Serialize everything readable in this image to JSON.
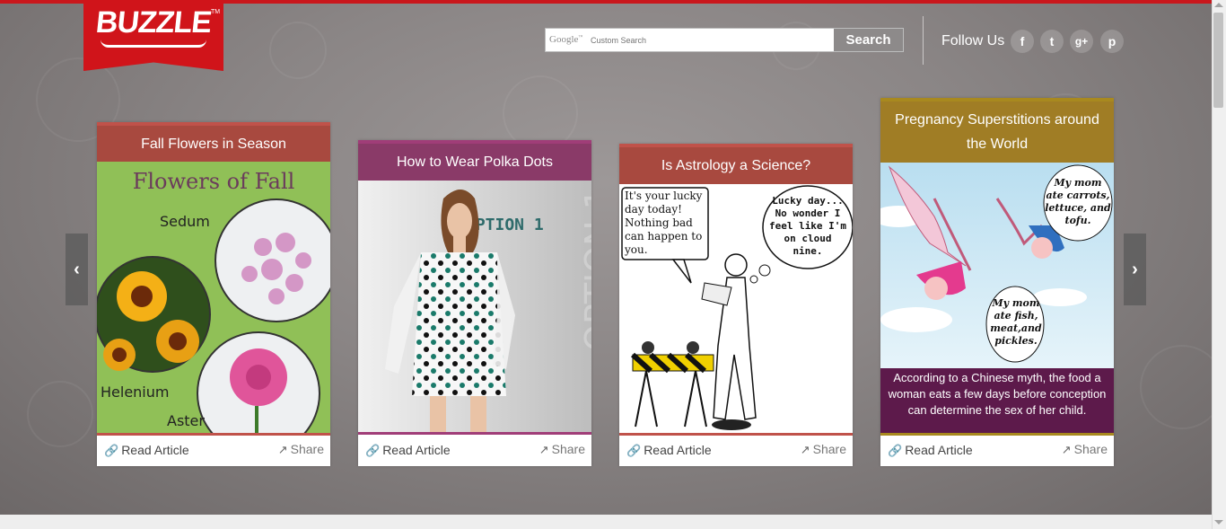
{
  "brand": {
    "logo_text": "BUZZLE",
    "tm": "TM",
    "color": "#d0141a"
  },
  "search": {
    "google_label": "Google",
    "placeholder": "Custom Search",
    "button_label": "Search"
  },
  "social": {
    "follow_label": "Follow Us",
    "icons": [
      {
        "name": "facebook-icon",
        "glyph": "f"
      },
      {
        "name": "twitter-icon",
        "glyph": "t"
      },
      {
        "name": "google-plus-icon",
        "glyph": "g+"
      },
      {
        "name": "pinterest-icon",
        "glyph": "p"
      }
    ]
  },
  "carousel": {
    "prev_glyph": "‹",
    "next_glyph": "›",
    "cards": [
      {
        "title": "Fall Flowers in Season",
        "accent": "#c0524a",
        "title_bg": "#a8493f",
        "read_label": "Read Article",
        "share_label": "Share",
        "art": {
          "heading": "Flowers of Fall",
          "labels": [
            "Sedum",
            "Helenium",
            "Aster"
          ]
        }
      },
      {
        "title": "How to Wear Polka Dots",
        "accent": "#a03d78",
        "title_bg": "#8a3a68",
        "read_label": "Read Article",
        "share_label": "Share",
        "art": {
          "text": "OPTION 1"
        }
      },
      {
        "title": "Is Astrology a Science?",
        "accent": "#c0524a",
        "title_bg": "#a8493f",
        "read_label": "Read Article",
        "share_label": "Share",
        "art": {
          "bubble_left": "It's your lucky day today! Nothing bad can happen to you.",
          "bubble_right": "Lucky day... No wonder I feel like I'm on cloud nine."
        }
      },
      {
        "title": "Pregnancy Superstitions around the World",
        "accent": "#a8891f",
        "title_bg": "#a07d25",
        "read_label": "Read Article",
        "share_label": "Share",
        "art": {
          "bubble_top": "My mom ate carrots, lettuce, and tofu.",
          "bubble_bottom": "My mom ate fish, meat,and pickles.",
          "caption": "According to a Chinese myth, the food a woman eats a few days before conception can determine the sex of her child."
        }
      }
    ]
  }
}
